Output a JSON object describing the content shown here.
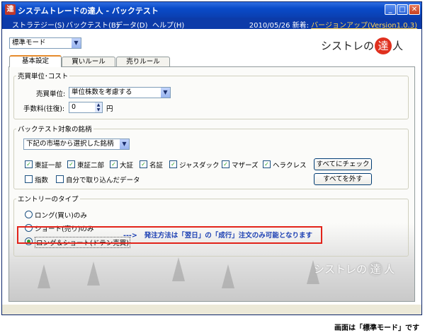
{
  "window": {
    "title": "システムトレードの達人 - バックテスト",
    "app_icon_glyph": "達",
    "min_glyph": "_",
    "max_glyph": "□",
    "close_glyph": "✕"
  },
  "menubar": {
    "items": [
      "ストラテジー(S)",
      "バックテスト(B)",
      "データ(D)",
      "ヘルプ(H)"
    ],
    "date_info": "2010/05/26 新着:",
    "version_link": "バージョンアップ(Version1.0.3)"
  },
  "mode_select": {
    "value": "標準モード"
  },
  "logo": {
    "pre": "シストレの",
    "mark": "達",
    "post": "人"
  },
  "tabs": [
    "基本設定",
    "買いルール",
    "売りルール"
  ],
  "unit_cost": {
    "legend": "売買単位･コスト",
    "unit_label": "売買単位:",
    "unit_value": "単位株数を考慮する",
    "fee_label": "手数料(往復):",
    "fee_value": "0",
    "fee_unit": "円"
  },
  "symbols": {
    "legend": "バックテスト対象の銘柄",
    "source_value": "下記の市場から選択した銘柄",
    "markets": [
      "東証一部",
      "東証二部",
      "大証",
      "名証",
      "ジャスダック",
      "マザーズ",
      "ヘラクレス"
    ],
    "extras": [
      "指数",
      "自分で取り込んだデータ"
    ],
    "check_all": "すべてにチェック",
    "uncheck_all": "すべてを外す",
    "check_glyph": "✓"
  },
  "entry": {
    "legend": "エントリーのタイプ",
    "options": [
      "ロング(買い)のみ",
      "ショート(売り)のみ",
      "ロング＆ショート(ドテン売買)"
    ]
  },
  "annotation": {
    "arrow": "--->",
    "text": "発注方法は「翌日」の「成行」注文のみ可能となります"
  },
  "caption": "画面は「標準モード」です",
  "spin_up": "▲",
  "spin_down": "▼",
  "dropdown_glyph": "▼"
}
